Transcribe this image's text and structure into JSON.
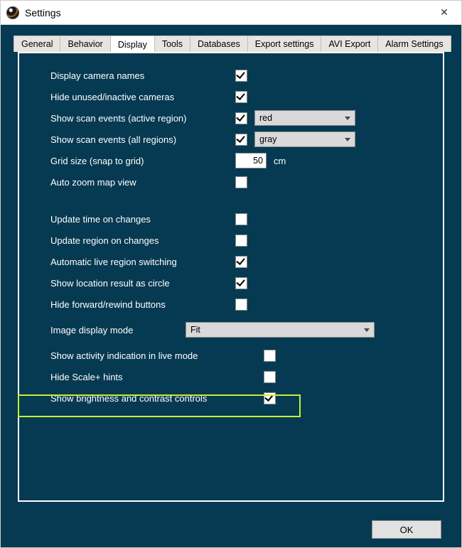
{
  "window": {
    "title": "Settings",
    "close_glyph": "✕"
  },
  "tabs": [
    {
      "label": "General"
    },
    {
      "label": "Behavior"
    },
    {
      "label": "Display"
    },
    {
      "label": "Tools"
    },
    {
      "label": "Databases"
    },
    {
      "label": "Export settings"
    },
    {
      "label": "AVI Export"
    },
    {
      "label": "Alarm Settings"
    }
  ],
  "rows": {
    "display_camera_names": {
      "label": "Display camera names",
      "checked": true
    },
    "hide_unused": {
      "label": "Hide unused/inactive cameras",
      "checked": true
    },
    "scan_active": {
      "label": "Show scan events (active region)",
      "checked": true,
      "color": "red"
    },
    "scan_all": {
      "label": "Show scan events (all regions)",
      "checked": true,
      "color": "gray"
    },
    "grid_size": {
      "label": "Grid size (snap to grid)",
      "value": "50",
      "unit": "cm"
    },
    "auto_zoom": {
      "label": "Auto zoom map view",
      "checked": false
    },
    "update_time": {
      "label": "Update time on changes",
      "checked": false
    },
    "update_region": {
      "label": "Update region on changes",
      "checked": false
    },
    "auto_switch": {
      "label": "Automatic live region switching",
      "checked": true
    },
    "loc_circle": {
      "label": "Show location result as circle",
      "checked": true
    },
    "hide_ffrw": {
      "label": "Hide forward/rewind buttons",
      "checked": false
    },
    "image_mode": {
      "label": "Image display mode",
      "value": "Fit"
    },
    "activity_live": {
      "label": "Show activity indication in live mode",
      "checked": false
    },
    "hide_scale_hints": {
      "label": "Hide Scale+ hints",
      "checked": false
    },
    "brightness_contrast": {
      "label": "Show brightness and contrast controls",
      "checked": true
    }
  },
  "footer": {
    "ok": "OK"
  }
}
